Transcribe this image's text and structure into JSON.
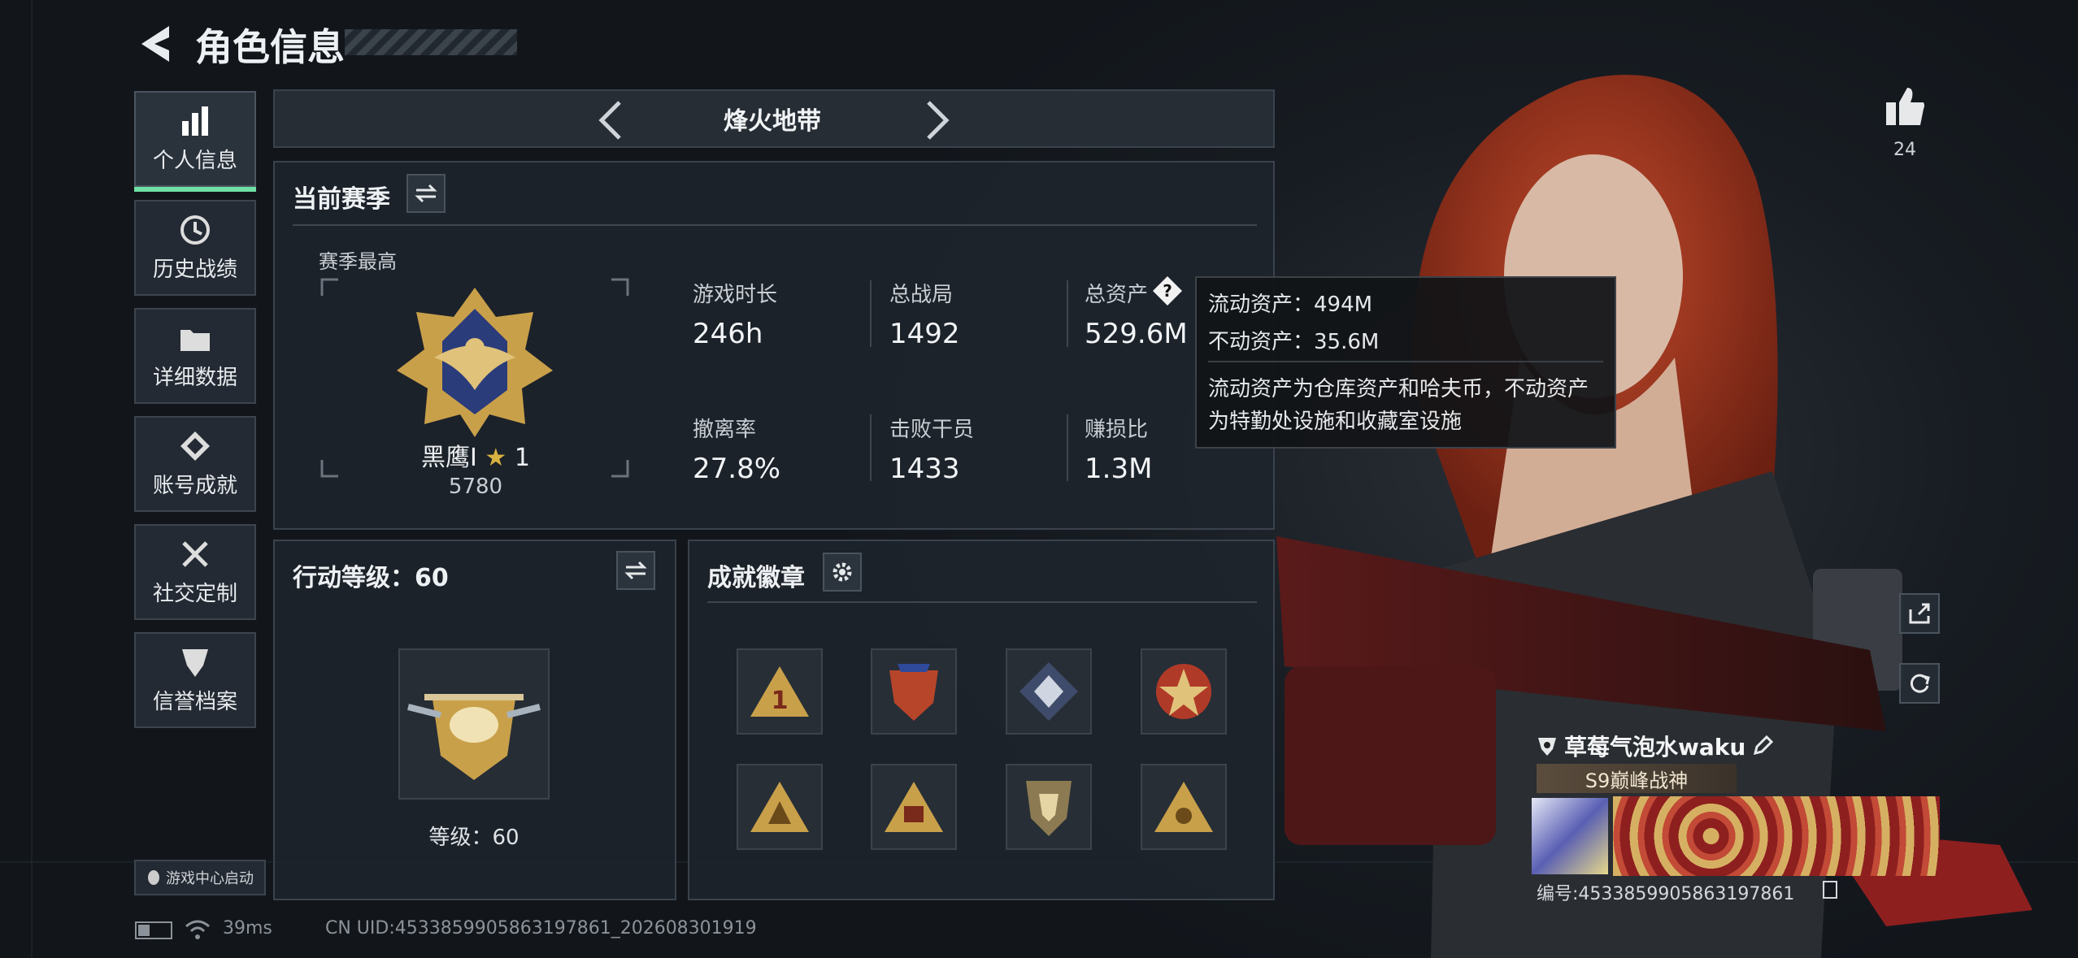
{
  "header": {
    "title": "角色信息"
  },
  "sidebar": {
    "items": [
      {
        "label": "个人信息"
      },
      {
        "label": "历史战绩"
      },
      {
        "label": "详细数据"
      },
      {
        "label": "账号成就"
      },
      {
        "label": "社交定制"
      },
      {
        "label": "信誉档案"
      }
    ],
    "launcher_label": "游戏中心启动"
  },
  "mode_selector": {
    "current": "烽火地带"
  },
  "season": {
    "title": "当前赛季",
    "best_label": "赛季最高",
    "rank_name": "黑鹰I",
    "rank_stars": "1",
    "rank_score": "5780",
    "stats": [
      {
        "label": "游戏时长",
        "value": "246h"
      },
      {
        "label": "总战局",
        "value": "1492"
      },
      {
        "label": "总资产",
        "value": "529.6M"
      },
      {
        "label": "撤离率",
        "value": "27.8%"
      },
      {
        "label": "击败干员",
        "value": "1433"
      },
      {
        "label": "赚损比",
        "value": "1.3M"
      }
    ]
  },
  "tooltip": {
    "liquid": "流动资产：494M",
    "fixed": "不动资产：35.6M",
    "desc1": "流动资产为仓库资产和哈夫币，不动资产",
    "desc2": "为特勤处设施和收藏室设施"
  },
  "action_level": {
    "title": "行动等级：60",
    "level_text": "等级：60"
  },
  "badges": {
    "title": "成就徽章",
    "items": [
      "badge-1",
      "badge-2",
      "badge-3",
      "badge-4",
      "badge-5",
      "badge-6",
      "badge-7",
      "badge-8"
    ]
  },
  "likes": {
    "count": "24"
  },
  "player": {
    "name": "草莓气泡水waku",
    "title": "S9巅峰战神",
    "id_text": "编号:4533859905863197861"
  },
  "status_bar": {
    "ping": "39ms",
    "uid": "CN UID:4533859905863197861_202608301919"
  },
  "colors": {
    "accent": "#6fe0a4",
    "gold": "#c9a04a",
    "hair": "#b23a22"
  }
}
